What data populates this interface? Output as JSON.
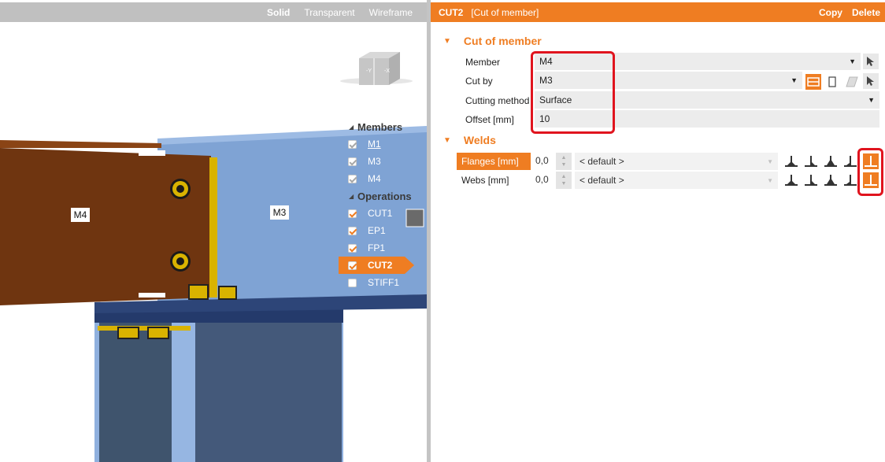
{
  "viewport": {
    "modes": [
      "Solid",
      "Transparent",
      "Wireframe"
    ],
    "active_mode": "Solid",
    "navcube": {
      "left_face": "-Y",
      "right_face": "-X"
    },
    "scene_labels": {
      "member_m4": "M4",
      "member_m3": "M3"
    }
  },
  "tree": {
    "members_heading": "Members",
    "members": [
      {
        "label": "M1",
        "checked": true,
        "dim": true
      },
      {
        "label": "M3",
        "checked": true,
        "dim": true
      },
      {
        "label": "M4",
        "checked": true,
        "dim": true
      }
    ],
    "operations_heading": "Operations",
    "operations": [
      {
        "label": "CUT1",
        "checked": true
      },
      {
        "label": "EP1",
        "checked": true
      },
      {
        "label": "FP1",
        "checked": true
      },
      {
        "label": "CUT2",
        "checked": true,
        "selected": true
      },
      {
        "label": "STIFF1",
        "checked": false
      }
    ]
  },
  "panel": {
    "header": {
      "name": "CUT2",
      "type": "[Cut of member]",
      "copy": "Copy",
      "delete": "Delete"
    },
    "cut_section": {
      "title": "Cut of member",
      "member": {
        "label": "Member",
        "value": "M4"
      },
      "cut_by": {
        "label": "Cut by",
        "value": "M3"
      },
      "method": {
        "label": "Cutting method",
        "value": "Surface"
      },
      "offset": {
        "label": "Offset [mm]",
        "value": "10"
      }
    },
    "welds_section": {
      "title": "Welds",
      "rows": [
        {
          "label": "Flanges [mm]",
          "value": "0,0",
          "type": "< default >",
          "selected": true
        },
        {
          "label": "Webs [mm]",
          "value": "0,0",
          "type": "< default >",
          "selected": false
        }
      ]
    }
  },
  "colors": {
    "accent": "#ef7d22",
    "highlight": "#e0141e",
    "member_m3": "#7fa3d4",
    "member_m4": "#6f3510",
    "column": "#3f546d",
    "bolts": "#d9b300"
  }
}
